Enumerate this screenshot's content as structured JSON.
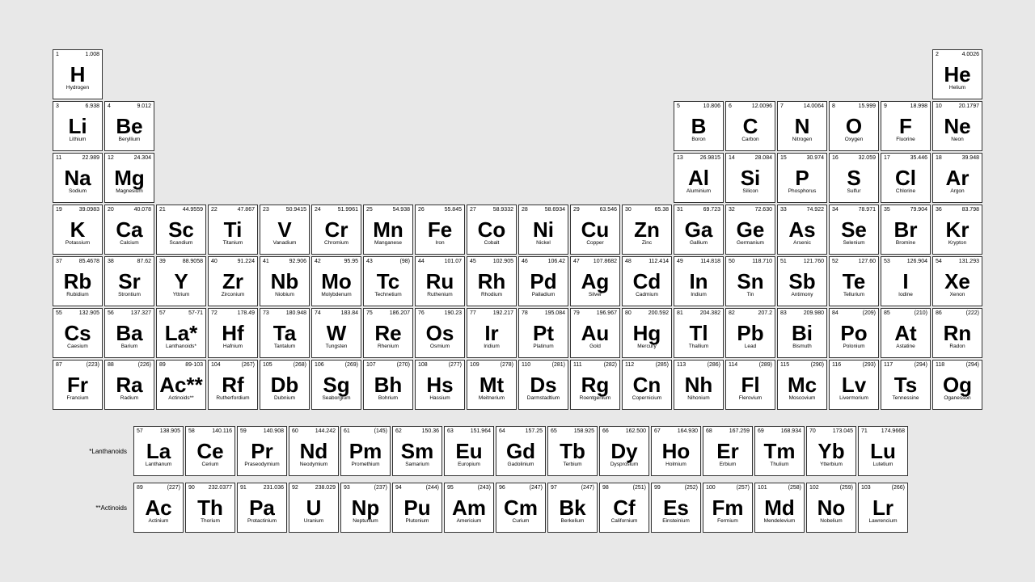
{
  "elements": [
    {
      "number": 1,
      "symbol": "H",
      "name": "Hydrogen",
      "mass": "1.008",
      "col": 1,
      "row": 1
    },
    {
      "number": 2,
      "symbol": "He",
      "name": "Helium",
      "mass": "4.0026",
      "col": 18,
      "row": 1
    },
    {
      "number": 3,
      "symbol": "Li",
      "name": "Lithium",
      "mass": "6.938",
      "col": 1,
      "row": 2
    },
    {
      "number": 4,
      "symbol": "Be",
      "name": "Beryllium",
      "mass": "9.012",
      "col": 2,
      "row": 2
    },
    {
      "number": 5,
      "symbol": "B",
      "name": "Boron",
      "mass": "10.806",
      "col": 13,
      "row": 2
    },
    {
      "number": 6,
      "symbol": "C",
      "name": "Carbon",
      "mass": "12.0096",
      "col": 14,
      "row": 2
    },
    {
      "number": 7,
      "symbol": "N",
      "name": "Nitrogen",
      "mass": "14.0064",
      "col": 15,
      "row": 2
    },
    {
      "number": 8,
      "symbol": "O",
      "name": "Oxygen",
      "mass": "15.999",
      "col": 16,
      "row": 2
    },
    {
      "number": 9,
      "symbol": "F",
      "name": "Fluorine",
      "mass": "18.998",
      "col": 17,
      "row": 2
    },
    {
      "number": 10,
      "symbol": "Ne",
      "name": "Neon",
      "mass": "20.1797",
      "col": 18,
      "row": 2
    },
    {
      "number": 11,
      "symbol": "Na",
      "name": "Sodium",
      "mass": "22.989",
      "col": 1,
      "row": 3
    },
    {
      "number": 12,
      "symbol": "Mg",
      "name": "Magnesium",
      "mass": "24.304",
      "col": 2,
      "row": 3
    },
    {
      "number": 13,
      "symbol": "Al",
      "name": "Aluminium",
      "mass": "26.9815",
      "col": 13,
      "row": 3
    },
    {
      "number": 14,
      "symbol": "Si",
      "name": "Silicon",
      "mass": "28.084",
      "col": 14,
      "row": 3
    },
    {
      "number": 15,
      "symbol": "P",
      "name": "Phosphorus",
      "mass": "30.974",
      "col": 15,
      "row": 3
    },
    {
      "number": 16,
      "symbol": "S",
      "name": "Sulfur",
      "mass": "32.059",
      "col": 16,
      "row": 3
    },
    {
      "number": 17,
      "symbol": "Cl",
      "name": "Chlorine",
      "mass": "35.446",
      "col": 17,
      "row": 3
    },
    {
      "number": 18,
      "symbol": "Ar",
      "name": "Argon",
      "mass": "39.948",
      "col": 18,
      "row": 3
    },
    {
      "number": 19,
      "symbol": "K",
      "name": "Potassium",
      "mass": "39.0983",
      "col": 1,
      "row": 4
    },
    {
      "number": 20,
      "symbol": "Ca",
      "name": "Calcium",
      "mass": "40.078",
      "col": 2,
      "row": 4
    },
    {
      "number": 21,
      "symbol": "Sc",
      "name": "Scandium",
      "mass": "44.9559",
      "col": 3,
      "row": 4
    },
    {
      "number": 22,
      "symbol": "Ti",
      "name": "Titanium",
      "mass": "47.867",
      "col": 4,
      "row": 4
    },
    {
      "number": 23,
      "symbol": "V",
      "name": "Vanadium",
      "mass": "50.9415",
      "col": 5,
      "row": 4
    },
    {
      "number": 24,
      "symbol": "Cr",
      "name": "Chromium",
      "mass": "51.9961",
      "col": 6,
      "row": 4
    },
    {
      "number": 25,
      "symbol": "Mn",
      "name": "Manganese",
      "mass": "54.938",
      "col": 7,
      "row": 4
    },
    {
      "number": 26,
      "symbol": "Fe",
      "name": "Iron",
      "mass": "55.845",
      "col": 8,
      "row": 4
    },
    {
      "number": 27,
      "symbol": "Co",
      "name": "Cobalt",
      "mass": "58.9332",
      "col": 9,
      "row": 4
    },
    {
      "number": 28,
      "symbol": "Ni",
      "name": "Nickel",
      "mass": "58.6934",
      "col": 10,
      "row": 4
    },
    {
      "number": 29,
      "symbol": "Cu",
      "name": "Copper",
      "mass": "63.546",
      "col": 11,
      "row": 4
    },
    {
      "number": 30,
      "symbol": "Zn",
      "name": "Zinc",
      "mass": "65.38",
      "col": 12,
      "row": 4
    },
    {
      "number": 31,
      "symbol": "Ga",
      "name": "Gallium",
      "mass": "69.723",
      "col": 13,
      "row": 4
    },
    {
      "number": 32,
      "symbol": "Ge",
      "name": "Germanium",
      "mass": "72.630",
      "col": 14,
      "row": 4
    },
    {
      "number": 33,
      "symbol": "As",
      "name": "Arsenic",
      "mass": "74.922",
      "col": 15,
      "row": 4
    },
    {
      "number": 34,
      "symbol": "Se",
      "name": "Selenium",
      "mass": "78.971",
      "col": 16,
      "row": 4
    },
    {
      "number": 35,
      "symbol": "Br",
      "name": "Bromine",
      "mass": "79.904",
      "col": 17,
      "row": 4
    },
    {
      "number": 36,
      "symbol": "Kr",
      "name": "Krypton",
      "mass": "83.798",
      "col": 18,
      "row": 4
    },
    {
      "number": 37,
      "symbol": "Rb",
      "name": "Rubidium",
      "mass": "85.4678",
      "col": 1,
      "row": 5
    },
    {
      "number": 38,
      "symbol": "Sr",
      "name": "Strontium",
      "mass": "87.62",
      "col": 2,
      "row": 5
    },
    {
      "number": 39,
      "symbol": "Y",
      "name": "Yttrium",
      "mass": "88.9058",
      "col": 3,
      "row": 5
    },
    {
      "number": 40,
      "symbol": "Zr",
      "name": "Zirconium",
      "mass": "91.224",
      "col": 4,
      "row": 5
    },
    {
      "number": 41,
      "symbol": "Nb",
      "name": "Niobium",
      "mass": "92.906",
      "col": 5,
      "row": 5
    },
    {
      "number": 42,
      "symbol": "Mo",
      "name": "Molybdenum",
      "mass": "95.95",
      "col": 6,
      "row": 5
    },
    {
      "number": 43,
      "symbol": "Tc",
      "name": "Technetium",
      "mass": "(98)",
      "col": 7,
      "row": 5
    },
    {
      "number": 44,
      "symbol": "Ru",
      "name": "Ruthenium",
      "mass": "101.07",
      "col": 8,
      "row": 5
    },
    {
      "number": 45,
      "symbol": "Rh",
      "name": "Rhodium",
      "mass": "102.905",
      "col": 9,
      "row": 5
    },
    {
      "number": 46,
      "symbol": "Pd",
      "name": "Palladium",
      "mass": "106.42",
      "col": 10,
      "row": 5
    },
    {
      "number": 47,
      "symbol": "Ag",
      "name": "Silver",
      "mass": "107.8682",
      "col": 11,
      "row": 5
    },
    {
      "number": 48,
      "symbol": "Cd",
      "name": "Cadmium",
      "mass": "112.414",
      "col": 12,
      "row": 5
    },
    {
      "number": 49,
      "symbol": "In",
      "name": "Indium",
      "mass": "114.818",
      "col": 13,
      "row": 5
    },
    {
      "number": 50,
      "symbol": "Sn",
      "name": "Tin",
      "mass": "118.710",
      "col": 14,
      "row": 5
    },
    {
      "number": 51,
      "symbol": "Sb",
      "name": "Antimony",
      "mass": "121.760",
      "col": 15,
      "row": 5
    },
    {
      "number": 52,
      "symbol": "Te",
      "name": "Tellurium",
      "mass": "127.60",
      "col": 16,
      "row": 5
    },
    {
      "number": 53,
      "symbol": "I",
      "name": "Iodine",
      "mass": "126.904",
      "col": 17,
      "row": 5
    },
    {
      "number": 54,
      "symbol": "Xe",
      "name": "Xenon",
      "mass": "131.293",
      "col": 18,
      "row": 5
    },
    {
      "number": 55,
      "symbol": "Cs",
      "name": "Caesium",
      "mass": "132.905",
      "col": 1,
      "row": 6
    },
    {
      "number": 56,
      "symbol": "Ba",
      "name": "Barium",
      "mass": "137.327",
      "col": 2,
      "row": 6
    },
    {
      "number": 57,
      "symbol": "La*",
      "name": "Lanthanoids*",
      "mass": "57-71",
      "col": 3,
      "row": 6,
      "special": true
    },
    {
      "number": 72,
      "symbol": "Hf",
      "name": "Hafnium",
      "mass": "178.49",
      "col": 4,
      "row": 6
    },
    {
      "number": 73,
      "symbol": "Ta",
      "name": "Tantalum",
      "mass": "180.948",
      "col": 5,
      "row": 6
    },
    {
      "number": 74,
      "symbol": "W",
      "name": "Tungsten",
      "mass": "183.84",
      "col": 6,
      "row": 6
    },
    {
      "number": 75,
      "symbol": "Re",
      "name": "Rhenium",
      "mass": "186.207",
      "col": 7,
      "row": 6
    },
    {
      "number": 76,
      "symbol": "Os",
      "name": "Osmium",
      "mass": "190.23",
      "col": 8,
      "row": 6
    },
    {
      "number": 77,
      "symbol": "Ir",
      "name": "Iridium",
      "mass": "192.217",
      "col": 9,
      "row": 6
    },
    {
      "number": 78,
      "symbol": "Pt",
      "name": "Platinum",
      "mass": "195.084",
      "col": 10,
      "row": 6
    },
    {
      "number": 79,
      "symbol": "Au",
      "name": "Gold",
      "mass": "196.967",
      "col": 11,
      "row": 6
    },
    {
      "number": 80,
      "symbol": "Hg",
      "name": "Mercury",
      "mass": "200.592",
      "col": 12,
      "row": 6
    },
    {
      "number": 81,
      "symbol": "Tl",
      "name": "Thallium",
      "mass": "204.382",
      "col": 13,
      "row": 6
    },
    {
      "number": 82,
      "symbol": "Pb",
      "name": "Lead",
      "mass": "207.2",
      "col": 14,
      "row": 6
    },
    {
      "number": 83,
      "symbol": "Bi",
      "name": "Bismuth",
      "mass": "209.980",
      "col": 15,
      "row": 6
    },
    {
      "number": 84,
      "symbol": "Po",
      "name": "Polonium",
      "mass": "(209)",
      "col": 16,
      "row": 6
    },
    {
      "number": 85,
      "symbol": "At",
      "name": "Astatine",
      "mass": "(210)",
      "col": 17,
      "row": 6
    },
    {
      "number": 86,
      "symbol": "Rn",
      "name": "Radon",
      "mass": "(222)",
      "col": 18,
      "row": 6
    },
    {
      "number": 87,
      "symbol": "Fr",
      "name": "Francium",
      "mass": "(223)",
      "col": 1,
      "row": 7
    },
    {
      "number": 88,
      "symbol": "Ra",
      "name": "Radium",
      "mass": "(226)",
      "col": 2,
      "row": 7
    },
    {
      "number": 89,
      "symbol": "Ac**",
      "name": "Actinoids**",
      "mass": "89-103",
      "col": 3,
      "row": 7,
      "special": true
    },
    {
      "number": 104,
      "symbol": "Rf",
      "name": "Rutherfordium",
      "mass": "(267)",
      "col": 4,
      "row": 7
    },
    {
      "number": 105,
      "symbol": "Db",
      "name": "Dubnium",
      "mass": "(268)",
      "col": 5,
      "row": 7
    },
    {
      "number": 106,
      "symbol": "Sg",
      "name": "Seaborgium",
      "mass": "(269)",
      "col": 6,
      "row": 7
    },
    {
      "number": 107,
      "symbol": "Bh",
      "name": "Bohrium",
      "mass": "(270)",
      "col": 7,
      "row": 7
    },
    {
      "number": 108,
      "symbol": "Hs",
      "name": "Hassium",
      "mass": "(277)",
      "col": 8,
      "row": 7
    },
    {
      "number": 109,
      "symbol": "Mt",
      "name": "Meitnerium",
      "mass": "(278)",
      "col": 9,
      "row": 7
    },
    {
      "number": 110,
      "symbol": "Ds",
      "name": "Darmstadtium",
      "mass": "(281)",
      "col": 10,
      "row": 7
    },
    {
      "number": 111,
      "symbol": "Rg",
      "name": "Roentgenium",
      "mass": "(282)",
      "col": 11,
      "row": 7
    },
    {
      "number": 112,
      "symbol": "Cn",
      "name": "Copernicium",
      "mass": "(285)",
      "col": 12,
      "row": 7
    },
    {
      "number": 113,
      "symbol": "Nh",
      "name": "Nihonium",
      "mass": "(286)",
      "col": 13,
      "row": 7
    },
    {
      "number": 114,
      "symbol": "Fl",
      "name": "Flerovium",
      "mass": "(289)",
      "col": 14,
      "row": 7
    },
    {
      "number": 115,
      "symbol": "Mc",
      "name": "Moscovium",
      "mass": "(290)",
      "col": 15,
      "row": 7
    },
    {
      "number": 116,
      "symbol": "Lv",
      "name": "Livermorium",
      "mass": "(293)",
      "col": 16,
      "row": 7
    },
    {
      "number": 117,
      "symbol": "Ts",
      "name": "Tennessine",
      "mass": "(294)",
      "col": 17,
      "row": 7
    },
    {
      "number": 118,
      "symbol": "Og",
      "name": "Oganesson",
      "mass": "(294)",
      "col": 18,
      "row": 7
    }
  ],
  "lanthanoids": [
    {
      "number": 57,
      "symbol": "La",
      "name": "Lanthanum",
      "mass": "138.905"
    },
    {
      "number": 58,
      "symbol": "Ce",
      "name": "Cerium",
      "mass": "140.116"
    },
    {
      "number": 59,
      "symbol": "Pr",
      "name": "Praseodymium",
      "mass": "140.908"
    },
    {
      "number": 60,
      "symbol": "Nd",
      "name": "Neodymium",
      "mass": "144.242"
    },
    {
      "number": 61,
      "symbol": "Pm",
      "name": "Promethium",
      "mass": "(145)"
    },
    {
      "number": 62,
      "symbol": "Sm",
      "name": "Samarium",
      "mass": "150.36"
    },
    {
      "number": 63,
      "symbol": "Eu",
      "name": "Europium",
      "mass": "151.964"
    },
    {
      "number": 64,
      "symbol": "Gd",
      "name": "Gadolinium",
      "mass": "157.25"
    },
    {
      "number": 65,
      "symbol": "Tb",
      "name": "Terbium",
      "mass": "158.925"
    },
    {
      "number": 66,
      "symbol": "Dy",
      "name": "Dysprosium",
      "mass": "162.500"
    },
    {
      "number": 67,
      "symbol": "Ho",
      "name": "Holmium",
      "mass": "164.930"
    },
    {
      "number": 68,
      "symbol": "Er",
      "name": "Erbium",
      "mass": "167.259"
    },
    {
      "number": 69,
      "symbol": "Tm",
      "name": "Thulium",
      "mass": "168.934"
    },
    {
      "number": 70,
      "symbol": "Yb",
      "name": "Ytterbium",
      "mass": "173.045"
    },
    {
      "number": 71,
      "symbol": "Lu",
      "name": "Lutetium",
      "mass": "174.9668"
    }
  ],
  "actinoids": [
    {
      "number": 89,
      "symbol": "Ac",
      "name": "Actinium",
      "mass": "(227)"
    },
    {
      "number": 90,
      "symbol": "Th",
      "name": "Thorium",
      "mass": "232.0377"
    },
    {
      "number": 91,
      "symbol": "Pa",
      "name": "Protactinium",
      "mass": "231.036"
    },
    {
      "number": 92,
      "symbol": "U",
      "name": "Uranium",
      "mass": "238.029"
    },
    {
      "number": 93,
      "symbol": "Np",
      "name": "Neptunium",
      "mass": "(237)"
    },
    {
      "number": 94,
      "symbol": "Pu",
      "name": "Plutonium",
      "mass": "(244)"
    },
    {
      "number": 95,
      "symbol": "Am",
      "name": "Americium",
      "mass": "(243)"
    },
    {
      "number": 96,
      "symbol": "Cm",
      "name": "Curium",
      "mass": "(247)"
    },
    {
      "number": 97,
      "symbol": "Bk",
      "name": "Berkelium",
      "mass": "(247)"
    },
    {
      "number": 98,
      "symbol": "Cf",
      "name": "Californium",
      "mass": "(251)"
    },
    {
      "number": 99,
      "symbol": "Es",
      "name": "Einsteinium",
      "mass": "(252)"
    },
    {
      "number": 100,
      "symbol": "Fm",
      "name": "Fermium",
      "mass": "(257)"
    },
    {
      "number": 101,
      "symbol": "Md",
      "name": "Mendelevium",
      "mass": "(258)"
    },
    {
      "number": 102,
      "symbol": "No",
      "name": "Nobelium",
      "mass": "(259)"
    },
    {
      "number": 103,
      "symbol": "Lr",
      "name": "Lawrencium",
      "mass": "(266)"
    }
  ],
  "labels": {
    "lanthanoids": "*Lanthanoids",
    "actinoids": "**Actinoids"
  }
}
